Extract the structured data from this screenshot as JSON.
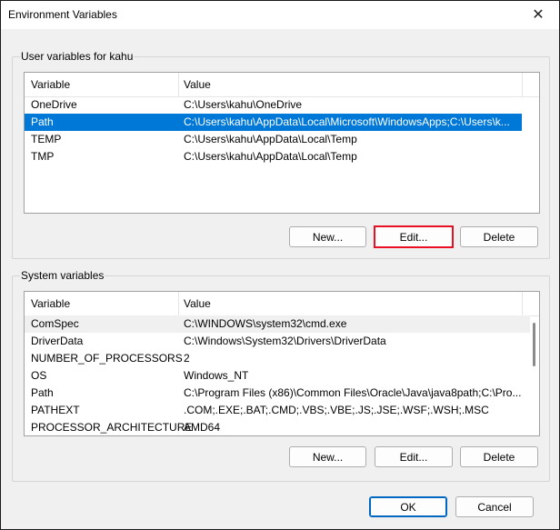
{
  "window": {
    "title": "Environment Variables",
    "close_glyph": "✕"
  },
  "user_group": {
    "label": "User variables for kahu",
    "columns": [
      "Variable",
      "Value"
    ],
    "rows": [
      {
        "variable": "OneDrive",
        "value": "C:\\Users\\kahu\\OneDrive"
      },
      {
        "variable": "Path",
        "value": "C:\\Users\\kahu\\AppData\\Local\\Microsoft\\WindowsApps;C:\\Users\\k..."
      },
      {
        "variable": "TEMP",
        "value": "C:\\Users\\kahu\\AppData\\Local\\Temp"
      },
      {
        "variable": "TMP",
        "value": "C:\\Users\\kahu\\AppData\\Local\\Temp"
      }
    ],
    "buttons": {
      "new": "New...",
      "edit": "Edit...",
      "delete": "Delete"
    }
  },
  "system_group": {
    "label": "System variables",
    "columns": [
      "Variable",
      "Value"
    ],
    "rows": [
      {
        "variable": "ComSpec",
        "value": "C:\\WINDOWS\\system32\\cmd.exe"
      },
      {
        "variable": "DriverData",
        "value": "C:\\Windows\\System32\\Drivers\\DriverData"
      },
      {
        "variable": "NUMBER_OF_PROCESSORS",
        "value": "2"
      },
      {
        "variable": "OS",
        "value": "Windows_NT"
      },
      {
        "variable": "Path",
        "value": "C:\\Program Files (x86)\\Common Files\\Oracle\\Java\\java8path;C:\\Pro..."
      },
      {
        "variable": "PATHEXT",
        "value": ".COM;.EXE;.BAT;.CMD;.VBS;.VBE;.JS;.JSE;.WSF;.WSH;.MSC"
      },
      {
        "variable": "PROCESSOR_ARCHITECTURE",
        "value": "AMD64"
      }
    ],
    "buttons": {
      "new": "New...",
      "edit": "Edit...",
      "delete": "Delete"
    }
  },
  "footer": {
    "ok": "OK",
    "cancel": "Cancel"
  },
  "colors": {
    "selection": "#0078d7",
    "focus_outline": "#e81123",
    "default_button": "#0067c0"
  }
}
